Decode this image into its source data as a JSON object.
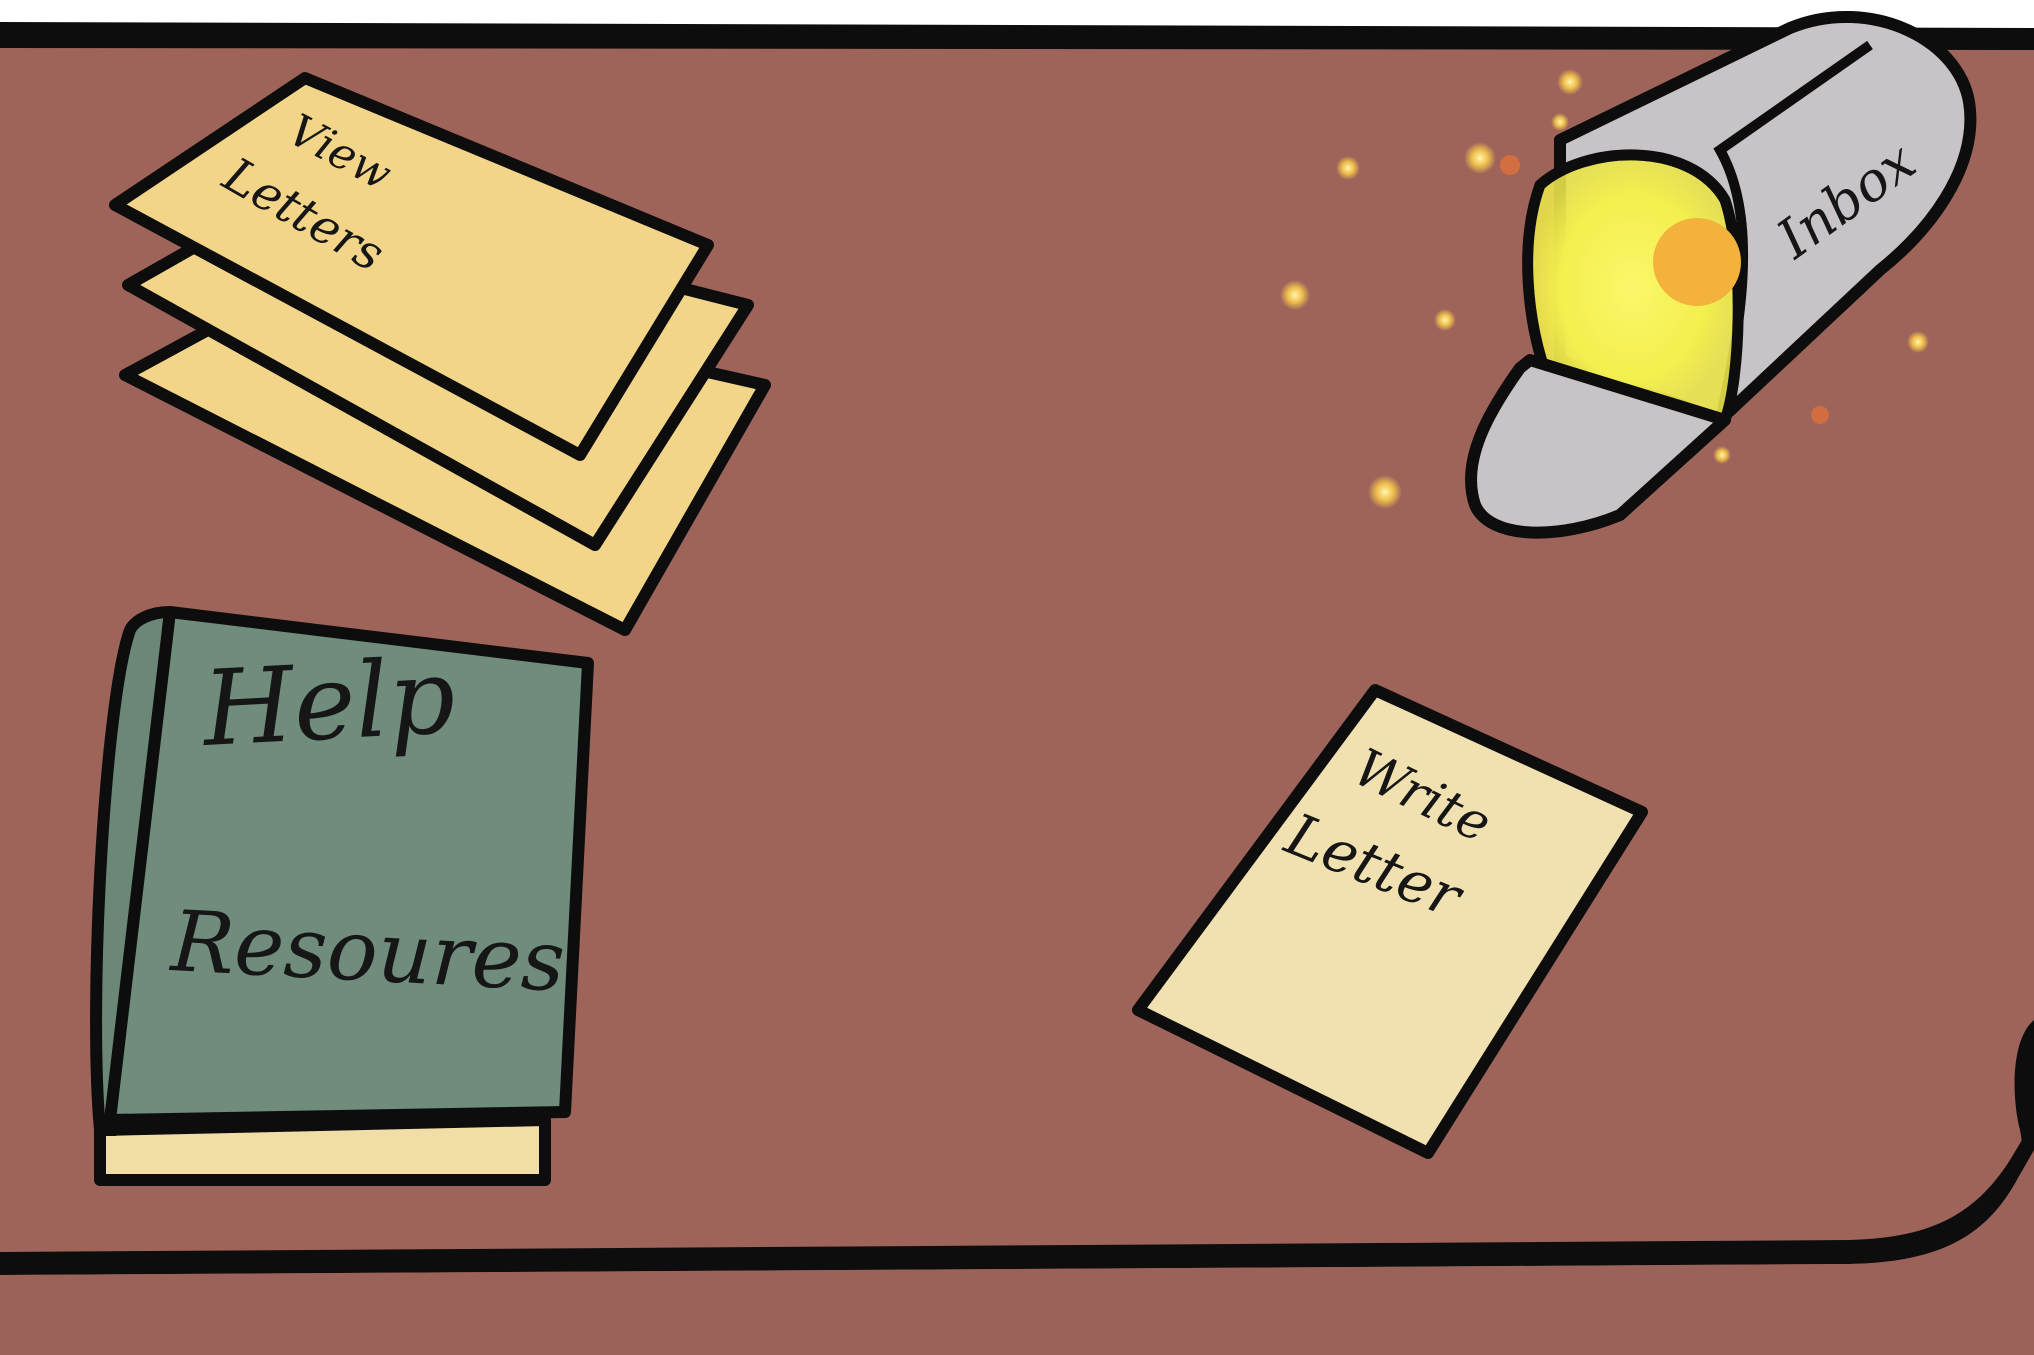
{
  "desk": {
    "surface_color": "#9e645a",
    "outline_color": "#0d0d0d"
  },
  "items": {
    "view_letters": {
      "line1": "View",
      "line2": "Letters",
      "paper_color": "#f3d58a"
    },
    "inbox": {
      "label": "Inbox",
      "body_color": "#c8c3c6",
      "glow_color": "#f7f25a",
      "glow_core_color": "#f2b23c"
    },
    "help_resources": {
      "line1": "Help",
      "line2": "Resoures",
      "cover_color": "#6f8c7d",
      "pages_color": "#f1dea6"
    },
    "write_letter": {
      "line1": "Write",
      "line2": "Letter",
      "paper_color": "#f2e1b0"
    }
  }
}
